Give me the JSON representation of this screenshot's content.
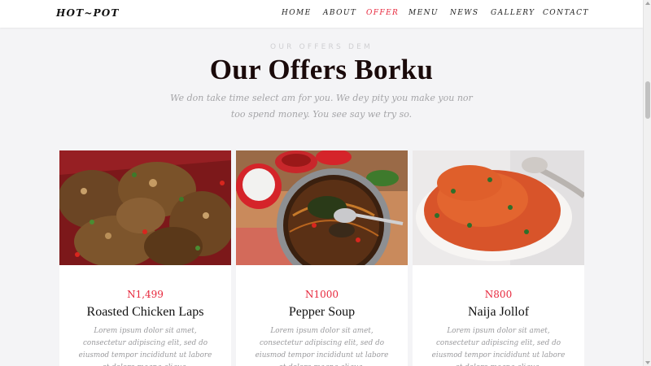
{
  "nav": {
    "logo": "HOT~POT",
    "items": [
      {
        "label": "HOME",
        "active": false
      },
      {
        "label": "ABOUT",
        "active": false
      },
      {
        "label": "OFFER",
        "active": true
      },
      {
        "label": "MENU",
        "active": false
      },
      {
        "label": "NEWS",
        "active": false
      },
      {
        "label": "GALLERY",
        "active": false
      },
      {
        "label": "CONTACT",
        "active": false
      }
    ]
  },
  "section": {
    "eyebrow": "OUR OFFERS DEM",
    "title": "Our Offers Borku",
    "subtitle": "We don take time select am for you. We dey pity you make you nor too spend money. You see say we try so."
  },
  "offers": [
    {
      "price": "N1,499",
      "name": "Roasted Chicken Laps",
      "description": "Lorem ipsum dolor sit amet, consectetur adipiscing elit, sed do eiusmod tempor incididunt ut labore et dolore magna aliqua."
    },
    {
      "price": "N1000",
      "name": "Pepper Soup",
      "description": "Lorem ipsum dolor sit amet, consectetur adipiscing elit, sed do eiusmod tempor incididunt ut labore et dolore magna aliqua."
    },
    {
      "price": "N800",
      "name": "Naija Jollof",
      "description": "Lorem ipsum dolor sit amet, consectetur adipiscing elit, sed do eiusmod tempor incididunt ut labore et dolore magna aliqua."
    }
  ],
  "colors": {
    "accent": "#e7273c",
    "page_background": "#f4f4f6",
    "card_background": "#ffffff",
    "text_dark": "#1a0a0a",
    "text_muted": "#a5a5a8"
  }
}
